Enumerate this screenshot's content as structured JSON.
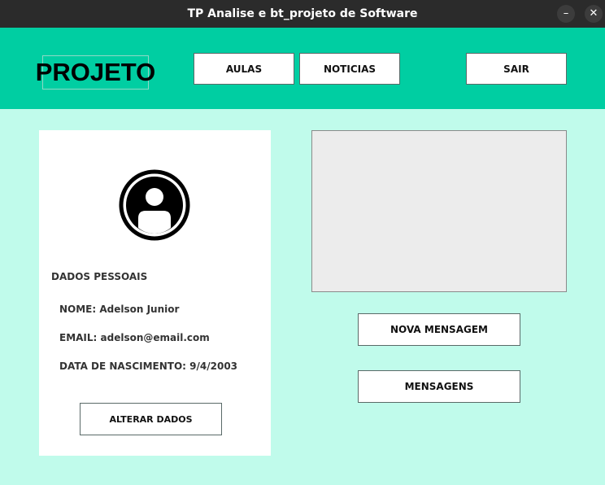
{
  "window": {
    "title": "TP Analise e bt_projeto de Software",
    "minimize_glyph": "–",
    "close_glyph": "✕"
  },
  "header": {
    "logo": "PROJETO",
    "nav": {
      "aulas": "AULAS",
      "noticias": "NOTICIAS",
      "sair": "SAIR"
    },
    "color": "#00cea2"
  },
  "profile": {
    "avatar_icon": "user-avatar-icon",
    "section_title": "DADOS PESSOAIS",
    "name_line": "NOME: Adelson Junior",
    "email_line": "EMAIL: adelson@email.com",
    "birth_line": "DATA DE NASCIMENTO: 9/4/2003",
    "alter_button": "ALTERAR DADOS"
  },
  "messages": {
    "nova_button": "NOVA MENSAGEM",
    "list_button": "MENSAGENS"
  },
  "colors": {
    "background": "#c0fbeb",
    "titlebar": "#2b2b2b",
    "card": "#ffffff",
    "message_box": "#ececec"
  }
}
